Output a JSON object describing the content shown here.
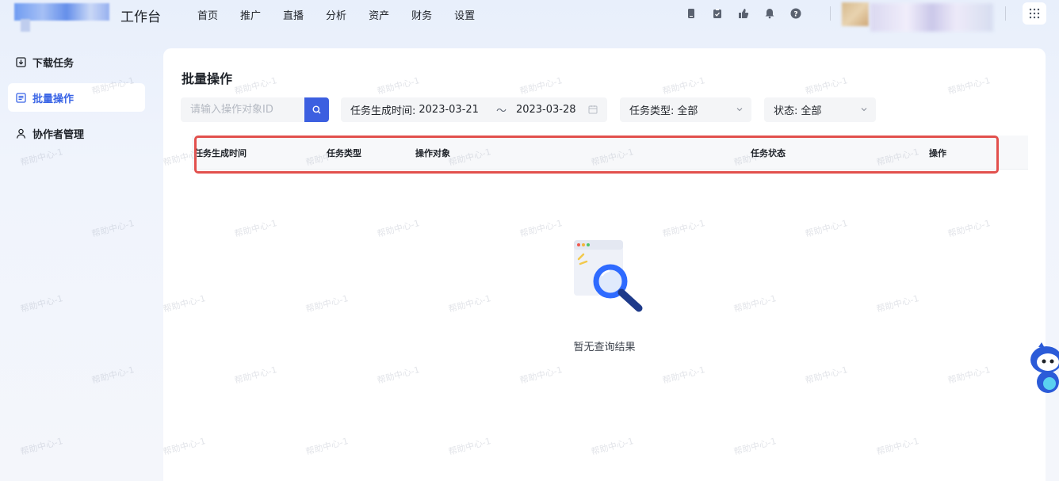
{
  "header": {
    "app_title": "工作台",
    "nav": [
      "首页",
      "推广",
      "直播",
      "分析",
      "资产",
      "财务",
      "设置"
    ],
    "icons": [
      "phone-icon",
      "clipboard-icon",
      "thumb-icon",
      "bell-icon",
      "help-icon"
    ]
  },
  "sidebar": {
    "items": [
      {
        "label": "下载任务",
        "icon": "download-icon"
      },
      {
        "label": "批量操作",
        "icon": "list-icon",
        "active": true
      },
      {
        "label": "协作者管理",
        "icon": "person-icon"
      }
    ]
  },
  "main": {
    "title": "批量操作",
    "search": {
      "placeholder": "请输入操作对象ID"
    },
    "date_filter": {
      "label": "任务生成时间:",
      "start": "2023-03-21",
      "separator": "～",
      "end": "2023-03-28"
    },
    "type_filter": {
      "label": "任务类型:",
      "value": "全部"
    },
    "status_filter": {
      "label": "状态:",
      "value": "全部"
    },
    "table": {
      "columns": [
        "任务生成时间",
        "任务类型",
        "操作对象",
        "任务状态",
        "操作"
      ]
    },
    "empty_text": "暂无查询结果"
  },
  "watermark": "帮助中心-1",
  "colors": {
    "accent": "#3c5fe0",
    "highlight": "#e2504d"
  }
}
